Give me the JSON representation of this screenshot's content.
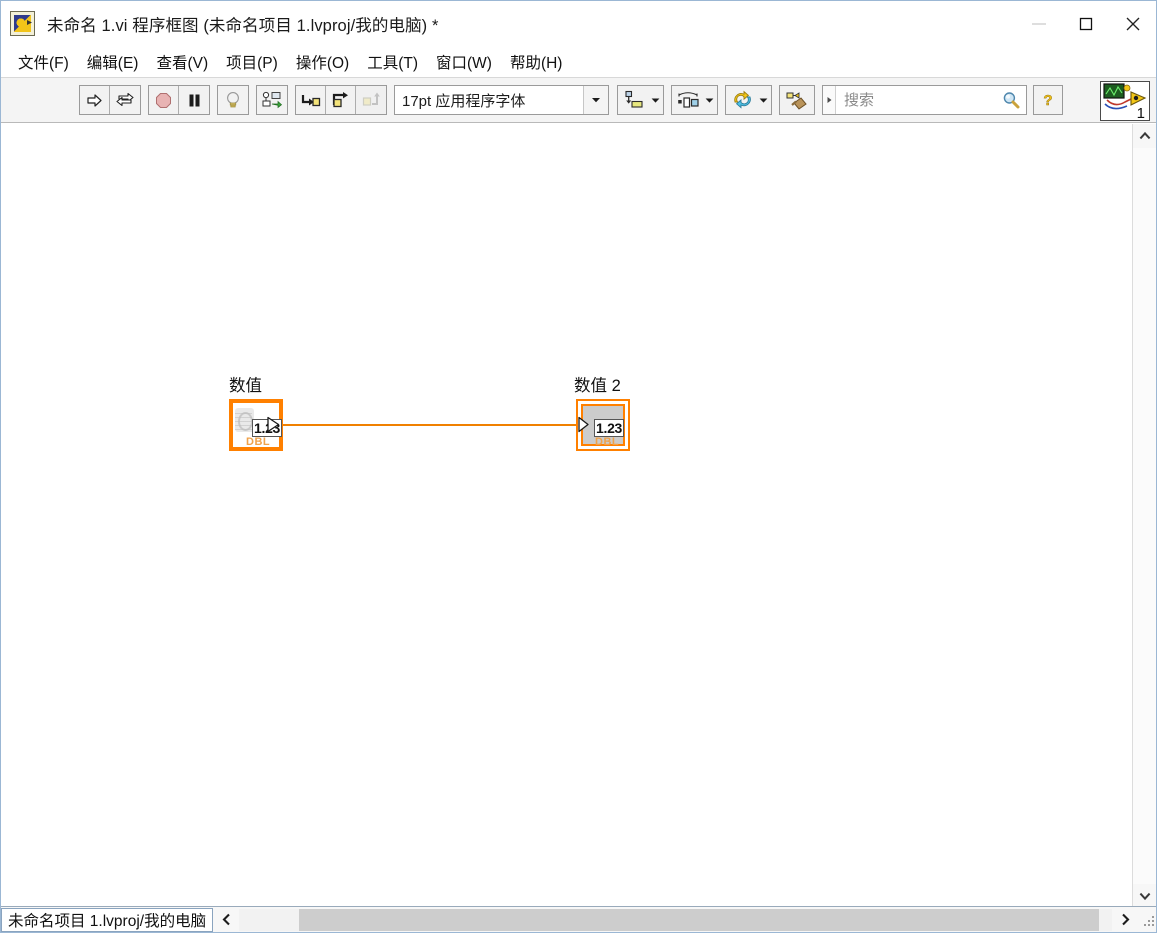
{
  "window": {
    "title": "未命名 1.vi 程序框图 (未命名项目 1.lvproj/我的电脑)  *",
    "app_icon": "labview-icon",
    "minimize_label": "—",
    "maximize_label": "□",
    "close_label": "×"
  },
  "menubar": {
    "items": [
      {
        "label": "文件(F)",
        "name": "menu-file"
      },
      {
        "label": "编辑(E)",
        "name": "menu-edit"
      },
      {
        "label": "查看(V)",
        "name": "menu-view"
      },
      {
        "label": "项目(P)",
        "name": "menu-project"
      },
      {
        "label": "操作(O)",
        "name": "menu-operate"
      },
      {
        "label": "工具(T)",
        "name": "menu-tools"
      },
      {
        "label": "窗口(W)",
        "name": "menu-window"
      },
      {
        "label": "帮助(H)",
        "name": "menu-help"
      }
    ]
  },
  "toolbar": {
    "run_title": "运行",
    "run_continuous_title": "连续运行",
    "abort_title": "中止执行",
    "pause_title": "暂停",
    "highlight_title": "高亮显示执行过程",
    "retain_values_title": "保存连线值",
    "step_into_title": "单步步入",
    "step_over_title": "单步步过",
    "step_out_title": "单步步出",
    "font_value": "17pt 应用程序字体",
    "align_title": "对齐对象",
    "distribute_title": "分布对象",
    "reorder_title": "重新排序",
    "cleanup_title": "整理程序框图",
    "help_label": "?",
    "vi_icon_number": "1"
  },
  "search": {
    "placeholder": "搜索",
    "value": ""
  },
  "diagram": {
    "control": {
      "label": "数值",
      "value": "1.23",
      "datatype": "DBL"
    },
    "indicator": {
      "label": "数值 2",
      "value": "1.23",
      "datatype": "DBL"
    },
    "wire_color": "#f08000",
    "terminal_border_color": "#ff8000"
  },
  "statusbar": {
    "path": "未命名项目 1.lvproj/我的电脑",
    "scroll_left": "‹",
    "scroll_right": "›"
  }
}
